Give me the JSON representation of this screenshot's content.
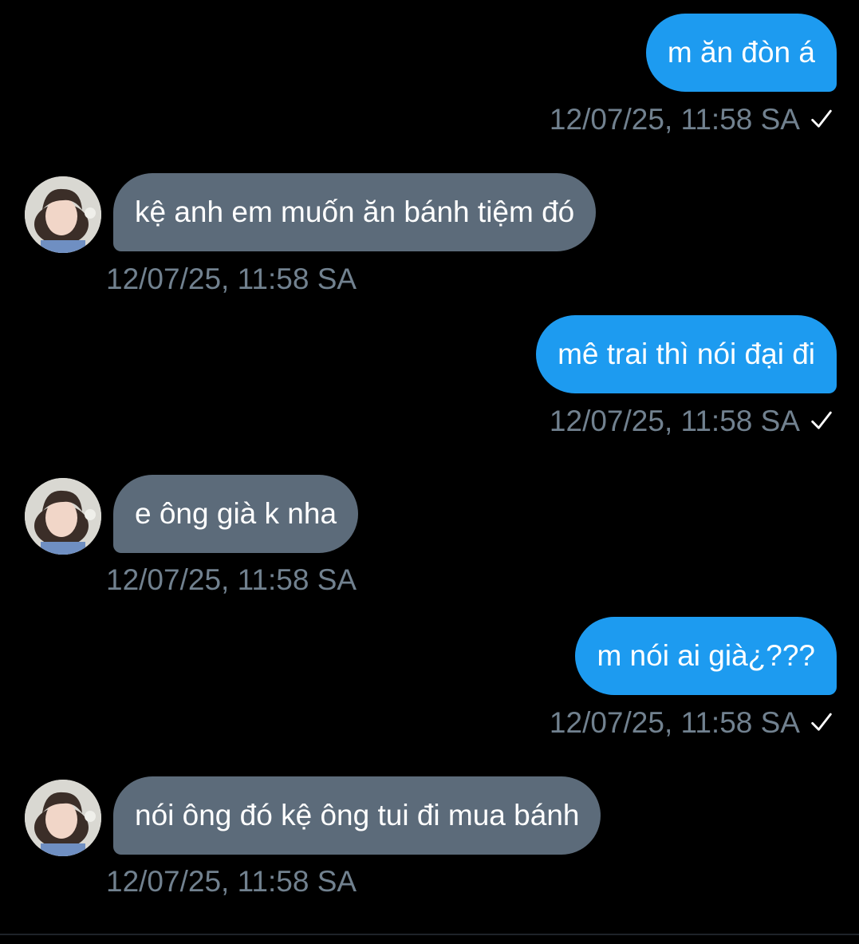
{
  "colors": {
    "background": "#000000",
    "sent_bubble": "#1d9bf0",
    "received_bubble": "#5c6b7a",
    "timestamp": "#71818f"
  },
  "messages": [
    {
      "direction": "sent",
      "text": "m ăn đòn á",
      "time": "12/07/25, 11:58 SA",
      "status_icon": "check-icon"
    },
    {
      "direction": "received",
      "text": "kệ anh em muốn ăn bánh tiệm đó",
      "time": "12/07/25, 11:58 SA",
      "avatar_icon": "avatar"
    },
    {
      "direction": "sent",
      "text": "mê trai thì nói đại đi",
      "time": "12/07/25, 11:58 SA",
      "status_icon": "check-icon"
    },
    {
      "direction": "received",
      "text": "e ông già k nha",
      "time": "12/07/25, 11:58 SA",
      "avatar_icon": "avatar"
    },
    {
      "direction": "sent",
      "text": "m nói ai già¿???",
      "time": "12/07/25, 11:58 SA",
      "status_icon": "check-icon"
    },
    {
      "direction": "received",
      "text": "nói ông đó kệ ông tui đi mua bánh",
      "time": "12/07/25, 11:58 SA",
      "avatar_icon": "avatar"
    }
  ]
}
